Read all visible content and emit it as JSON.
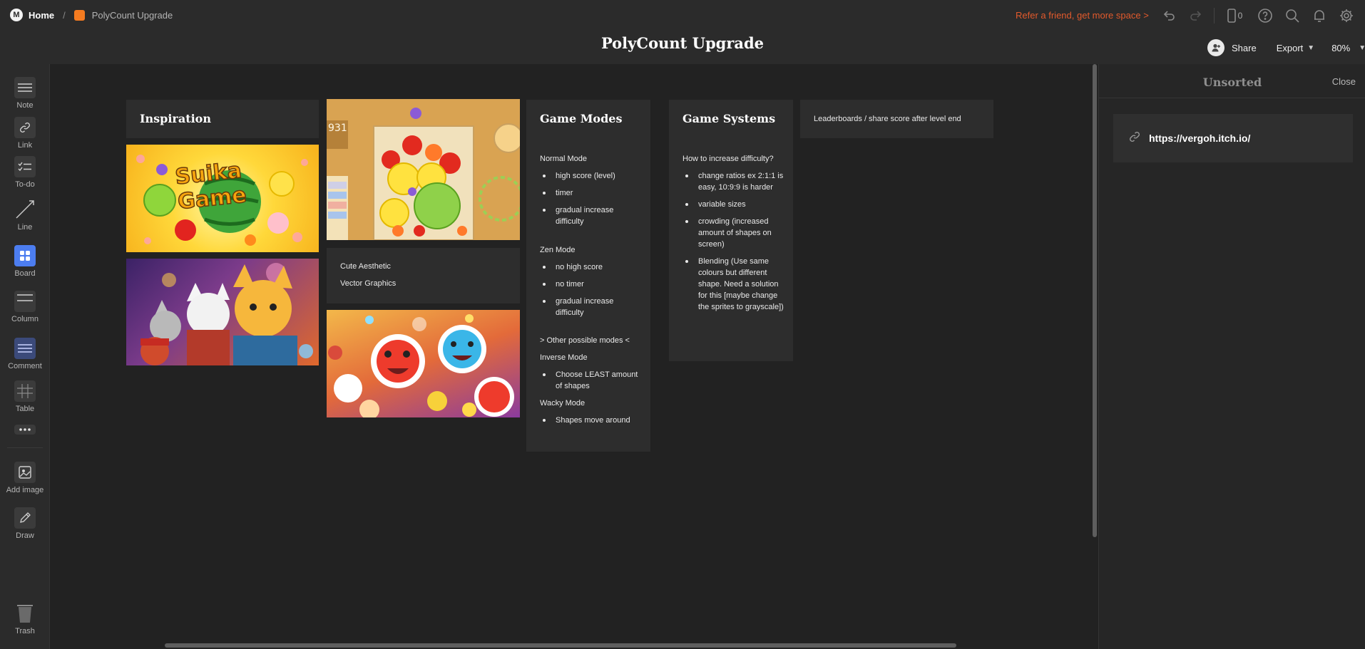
{
  "header": {
    "home_label": "Home",
    "board_name": "PolyCount Upgrade",
    "title": "PolyCount Upgrade",
    "refer_text": "Refer a friend, get more space >",
    "device_count": "0",
    "share_label": "Share",
    "export_label": "Export",
    "zoom": "80%"
  },
  "toolbar": {
    "note": "Note",
    "link": "Link",
    "todo": "To-do",
    "line": "Line",
    "board": "Board",
    "column": "Column",
    "comment": "Comment",
    "table": "Table",
    "add_image": "Add image",
    "draw": "Draw",
    "trash": "Trash"
  },
  "canvas": {
    "inspiration": {
      "title": "Inspiration",
      "image1_text": "Suika Game"
    },
    "aesthetic": {
      "line1": "Cute Aesthetic",
      "line2": "Vector Graphics"
    },
    "game_modes": {
      "title": "Game Modes",
      "normal_heading": "Normal Mode",
      "normal_items": [
        "high score (level)",
        "timer",
        "gradual increase difficulty"
      ],
      "zen_heading": "Zen Mode",
      "zen_items": [
        "no high score",
        "no timer",
        "gradual increase difficulty"
      ],
      "other_heading": "> Other possible modes <",
      "inverse_heading": "Inverse Mode",
      "inverse_items": [
        "Choose LEAST amount of shapes"
      ],
      "wacky_heading": "Wacky Mode",
      "wacky_items": [
        "Shapes move around"
      ]
    },
    "game_systems": {
      "title": "Game Systems",
      "question": "How to increase difficulty?",
      "items": [
        "change ratios ex 2:1:1 is easy, 10:9:9 is harder",
        "variable sizes",
        "crowding (increased amount of shapes on screen)",
        "Blending (Use same colours but different shape. Need a solution for this [maybe change the sprites to grayscale])"
      ]
    },
    "leaderboard_note": "Leaderboards / share score after level end"
  },
  "right_panel": {
    "title": "Unsorted",
    "close_label": "Close",
    "link_url": "https://vergoh.itch.io/"
  }
}
